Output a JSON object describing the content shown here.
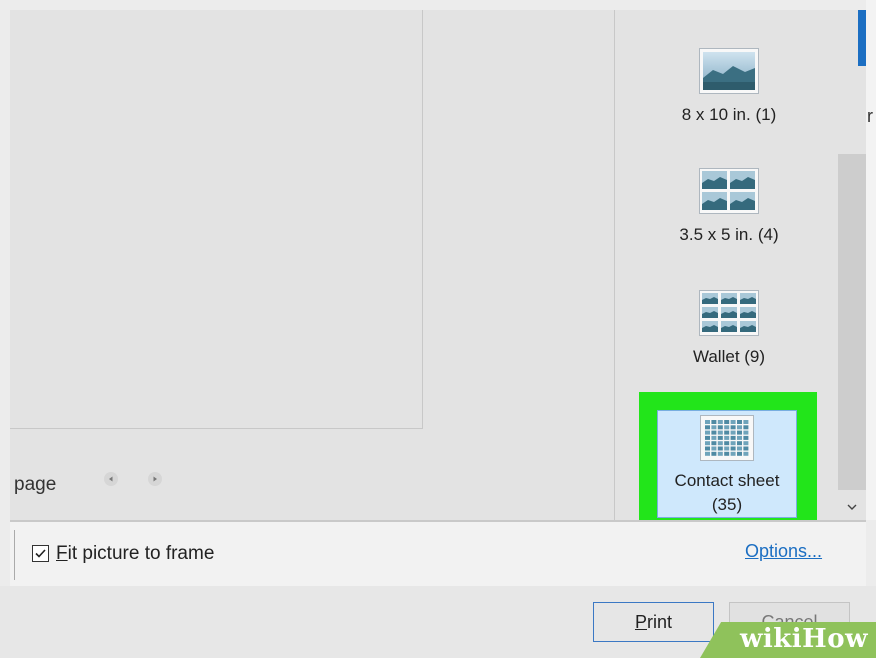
{
  "preview": {
    "page_label": "page"
  },
  "layouts": [
    {
      "label": "8 x 10 in. (1)",
      "icon": "single-photo-icon"
    },
    {
      "label": "3.5 x 5 in. (4)",
      "icon": "four-photos-icon"
    },
    {
      "label": "Wallet (9)",
      "icon": "nine-photos-icon"
    },
    {
      "label": "Contact sheet",
      "count": "(35)",
      "icon": "contact-sheet-icon",
      "selected": true
    }
  ],
  "right_cut_text": "r",
  "options": {
    "fit_checked": true,
    "fit_first_letter": "F",
    "fit_rest": "it picture to frame",
    "options_link": "Options..."
  },
  "buttons": {
    "print_first": "P",
    "print_rest": "rint",
    "cancel": "Cancel"
  },
  "watermark": {
    "wiki": "wiki",
    "how": "How"
  },
  "colors": {
    "highlight": "#22e51a",
    "selected_bg": "#cfe8fc",
    "accent": "#1b6ec2",
    "watermark": "#8fc25b"
  }
}
